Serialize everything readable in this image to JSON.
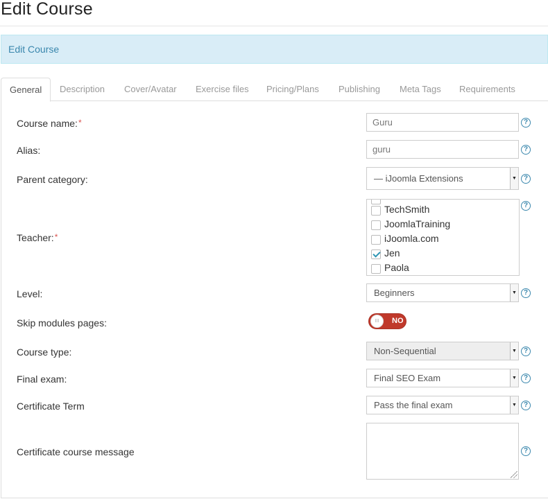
{
  "page": {
    "title": "Edit Course"
  },
  "info_bar": {
    "text": "Edit Course"
  },
  "tabs": [
    {
      "label": "General",
      "active": true
    },
    {
      "label": "Description"
    },
    {
      "label": "Cover/Avatar"
    },
    {
      "label": "Exercise files"
    },
    {
      "label": "Pricing/Plans"
    },
    {
      "label": "Publishing"
    },
    {
      "label": "Meta Tags"
    },
    {
      "label": "Requirements"
    }
  ],
  "form": {
    "required_marker": "*",
    "help_glyph": "?",
    "course_name": {
      "label": "Course name:",
      "value": "Guru"
    },
    "alias": {
      "label": "Alias:",
      "value": "guru"
    },
    "parent_category": {
      "label": "Parent category:",
      "value": "— iJoomla Extensions"
    },
    "teacher": {
      "label": "Teacher:",
      "options": [
        {
          "name": "TechSmith",
          "checked": false
        },
        {
          "name": "JoomlaTraining",
          "checked": false
        },
        {
          "name": "iJoomla.com",
          "checked": false
        },
        {
          "name": "Jen",
          "checked": true
        },
        {
          "name": "Paola",
          "checked": false
        }
      ]
    },
    "level": {
      "label": "Level:",
      "value": "Beginners"
    },
    "skip_modules": {
      "label": "Skip modules pages:",
      "toggle_text": "NO",
      "knob_glyph": "III",
      "enabled": false
    },
    "course_type": {
      "label": "Course type:",
      "value": "Non-Sequential"
    },
    "final_exam": {
      "label": "Final exam:",
      "value": "Final SEO Exam"
    },
    "certificate_term": {
      "label": "Certificate Term",
      "value": "Pass the final exam"
    },
    "certificate_message": {
      "label": "Certificate course message",
      "value": ""
    }
  },
  "icons": {
    "caret": "▼",
    "toggle_color": "#c0392b",
    "accent": "#3a87ad"
  }
}
